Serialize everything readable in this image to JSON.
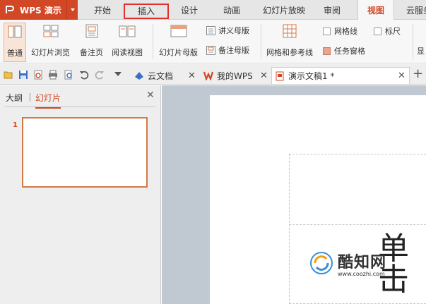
{
  "app": {
    "title": "WPS 演示"
  },
  "menu": {
    "tabs": [
      "开始",
      "插入",
      "设计",
      "动画",
      "幻灯片放映",
      "审阅",
      "视图",
      "云服务"
    ]
  },
  "ribbon": {
    "normal": "普通",
    "slide_browse": "幻灯片浏览",
    "notes_page": "备注页",
    "reading_view": "阅读视图",
    "slide_master": "幻灯片母版",
    "handout_master": "讲义母版",
    "notes_master": "备注母版",
    "grid_guides": "网格和参考线",
    "gridlines": "网格线",
    "ruler": "标尺",
    "task_pane": "任务窗格",
    "display": "显"
  },
  "doc_tabs": [
    {
      "label": "云文档"
    },
    {
      "label": "我的WPS"
    },
    {
      "label": "演示文稿1 *"
    }
  ],
  "left_panel": {
    "outline": "大纲",
    "slides": "幻灯片",
    "slide_number": "1"
  },
  "editor": {
    "partial_text": "单击"
  },
  "watermark": {
    "name": "酷知网",
    "url": "www.coozhi.com"
  },
  "colors": {
    "accent": "#d24726",
    "highlight": "#e0312d"
  }
}
